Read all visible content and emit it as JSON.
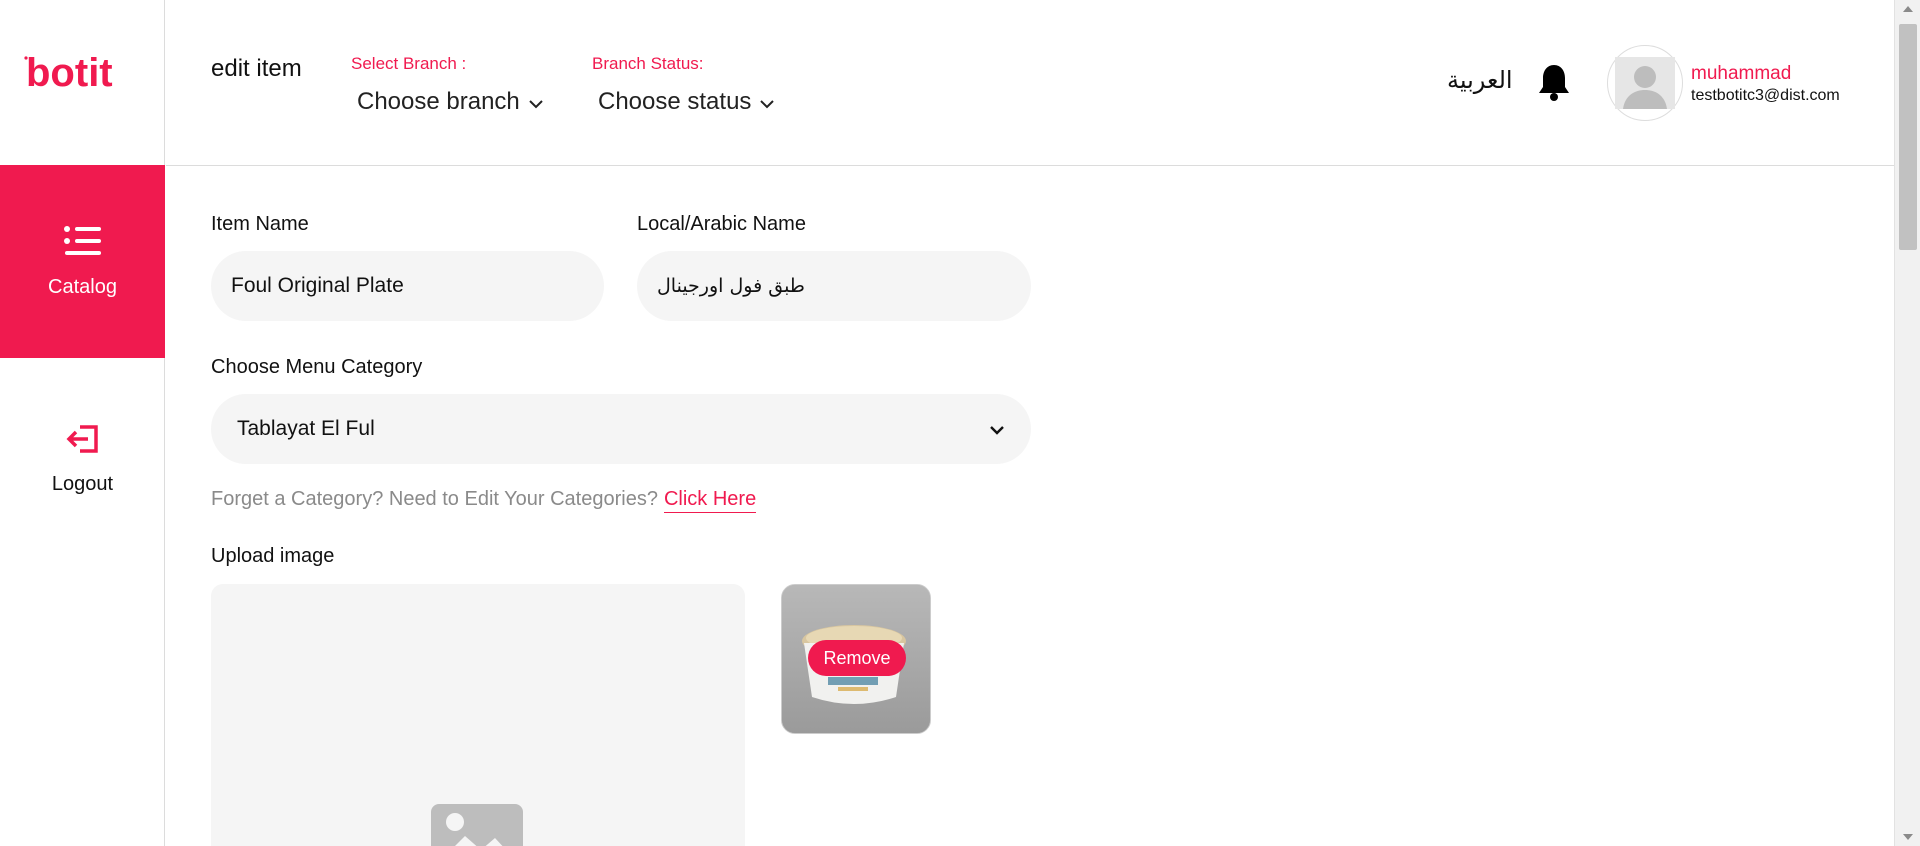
{
  "brand": {
    "logo_text": "botit",
    "accent_color": "#f01a4f"
  },
  "sidebar": {
    "items": [
      {
        "label": "Catalog",
        "icon": "list-icon",
        "active": true
      },
      {
        "label": "Logout",
        "icon": "logout-icon",
        "active": false
      }
    ]
  },
  "header": {
    "title": "edit item",
    "branch": {
      "label": "Select Branch :",
      "value": "Choose branch"
    },
    "status": {
      "label": "Branch Status:",
      "value": "Choose status"
    },
    "language": "العربية",
    "user": {
      "name": "muhammad",
      "email": "testbotitc3@dist.com"
    }
  },
  "form": {
    "item_name": {
      "label": "Item Name",
      "value": "Foul Original Plate"
    },
    "local_name": {
      "label": "Local/Arabic Name",
      "value": "طبق فول اورجينال"
    },
    "category": {
      "label": "Choose Menu Category",
      "value": "Tablayat El Ful"
    },
    "hint": {
      "text": "Forget a Category? Need to Edit Your Categories?",
      "link": "Click Here"
    },
    "upload": {
      "label": "Upload image",
      "remove_label": "Remove"
    }
  }
}
